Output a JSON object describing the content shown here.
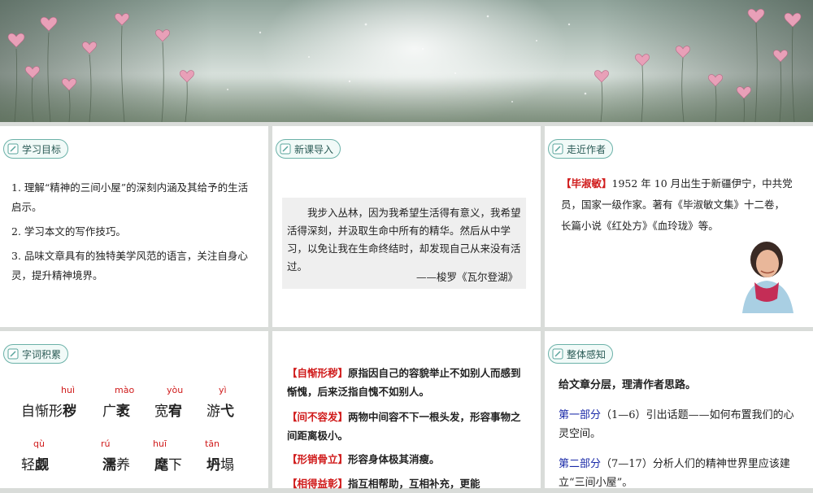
{
  "panels": {
    "goals": {
      "badge": "学习目标",
      "items": [
        "1. 理解“精神的三间小屋”的深刻内涵及其给予的生活启示。",
        "2. 学习本文的写作技巧。",
        "3. 品味文章具有的独特美学风范的语言，关注自身心灵，提升精神境界。"
      ]
    },
    "intro": {
      "badge": "新课导入",
      "quote": "我步入丛林，因为我希望生活得有意义，我希望活得深刻，并汲取生命中所有的精华。然后从中学习，以免让我在生命终结时，却发现自己从来没有活过。",
      "source": "——梭罗《瓦尔登湖》"
    },
    "author": {
      "badge": "走近作者",
      "name": "【毕淑敏】",
      "bio": "1952 年 10 月出生于新疆伊宁，中共党员，国家一级作家。著有《毕淑敏文集》十二卷，长篇小说《红处方》《血玲珑》等。"
    },
    "vocab": {
      "badge": "字词积累",
      "rows": [
        [
          {
            "pre": "自惭形",
            "bold": "秽",
            "post": "",
            "pinyin": "huì"
          },
          {
            "pre": "广",
            "bold": "袤",
            "post": "",
            "pinyin": "mào"
          },
          {
            "pre": "宽",
            "bold": "宥",
            "post": "",
            "pinyin": "yòu"
          },
          {
            "pre": "游",
            "bold": "弋",
            "post": "",
            "pinyin": "yì"
          }
        ],
        [
          {
            "pre": "轻",
            "bold": "觑",
            "post": "",
            "pinyin": "qù"
          },
          {
            "pre": "",
            "bold": "濡",
            "post": "养",
            "pinyin": "rú"
          },
          {
            "pre": "",
            "bold": "麾",
            "post": "下",
            "pinyin": "huī"
          },
          {
            "pre": "",
            "bold": "坍",
            "post": "塌",
            "pinyin": "tān"
          }
        ]
      ]
    },
    "definitions": {
      "items": [
        {
          "term": "【自惭形秽】",
          "text": "原指因自己的容貌举止不如别人而感到惭愧，后来泛指自愧不如别人。"
        },
        {
          "term": "【间不容发】",
          "text": "两物中间容不下一根头发，形容事物之间距离极小。"
        },
        {
          "term": "【形销骨立】",
          "text": "形容身体极其消瘦。"
        },
        {
          "term": "【相得益彰】",
          "text": "指互相帮助，互相补充，更能"
        }
      ]
    },
    "overview": {
      "badge": "整体感知",
      "heading": "给文章分层，理清作者思路。",
      "parts": [
        {
          "label": "第一部分",
          "range": "（1—6）",
          "text": "引出话题——如何布置我们的心灵空间。"
        },
        {
          "label": "第二部分",
          "range": "（7—17）",
          "text": "分析人们的精神世界里应该建立“三间小屋”。"
        }
      ]
    }
  },
  "colors": {
    "accent": "#6bb1a8",
    "term": "#d01b1b",
    "label": "#1a2aa8"
  }
}
